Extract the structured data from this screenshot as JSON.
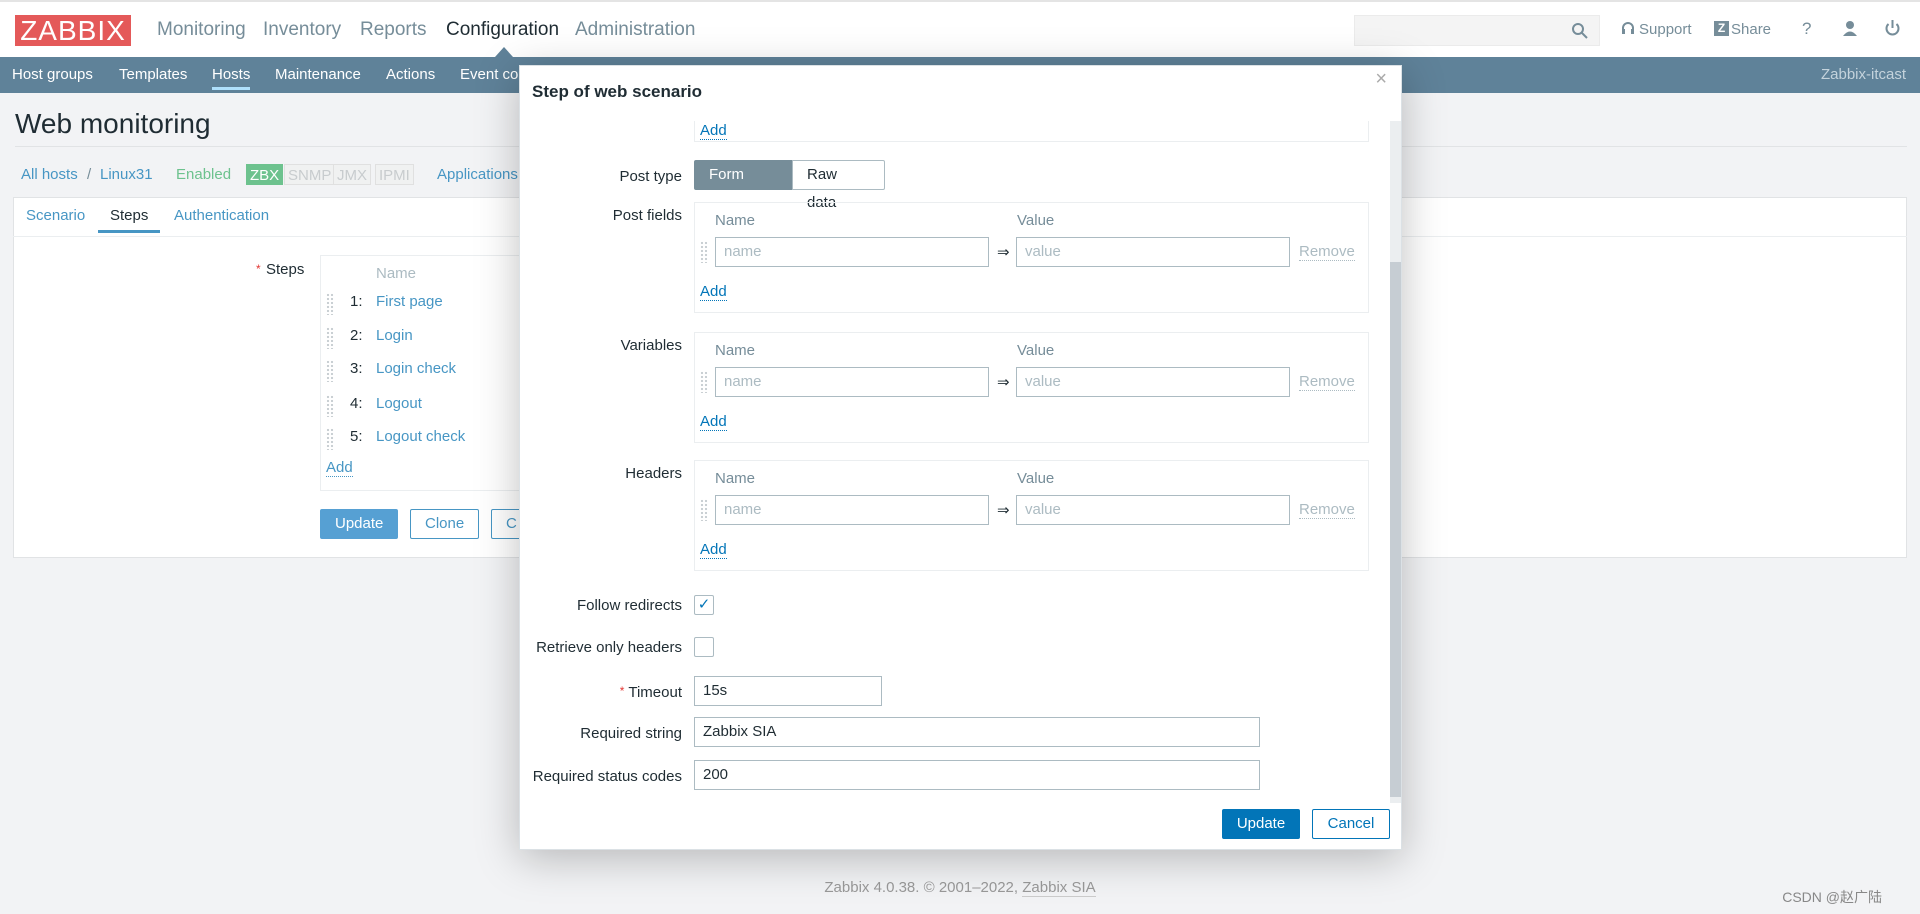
{
  "header": {
    "logo": "ZABBIX",
    "nav": [
      "Monitoring",
      "Inventory",
      "Reports",
      "Configuration",
      "Administration"
    ],
    "active_nav": "Configuration",
    "support": "Support",
    "share": "Share",
    "help": "?",
    "icons": [
      "search-icon",
      "headset-icon",
      "zabbix-share-icon",
      "help-icon",
      "user-icon",
      "power-icon"
    ]
  },
  "subnav": {
    "items": [
      "Host groups",
      "Templates",
      "Hosts",
      "Maintenance",
      "Actions",
      "Event co"
    ],
    "active": "Hosts",
    "server_name": "Zabbix-itcast"
  },
  "page": {
    "title": "Web monitoring",
    "breadcrumb": {
      "all_hosts": "All hosts",
      "sep": "/",
      "host": "Linux31",
      "status": "Enabled",
      "badges": [
        "ZBX",
        "SNMP",
        "JMX",
        "IPMI"
      ],
      "applications": "Applications"
    },
    "tabs": [
      "Scenario",
      "Steps",
      "Authentication"
    ],
    "active_tab": "Steps",
    "steps": {
      "label": "Steps",
      "required": "*",
      "name_header": "Name",
      "rows": [
        {
          "num": "1:",
          "name": "First page"
        },
        {
          "num": "2:",
          "name": "Login"
        },
        {
          "num": "3:",
          "name": "Login check"
        },
        {
          "num": "4:",
          "name": "Logout"
        },
        {
          "num": "5:",
          "name": "Logout check"
        }
      ],
      "add": "Add"
    },
    "buttons": {
      "update": "Update",
      "clone": "Clone",
      "third": "C"
    }
  },
  "dialog": {
    "title": "Step of web scenario",
    "close": "×",
    "top_add": "Add",
    "post_type": {
      "label": "Post type",
      "options": [
        "Form data",
        "Raw data"
      ],
      "selected": "Form data"
    },
    "sections": [
      {
        "label": "Post fields",
        "name_header": "Name",
        "value_header": "Value",
        "name_placeholder": "name",
        "value_placeholder": "value",
        "arrow": "⇒",
        "remove": "Remove",
        "add": "Add"
      },
      {
        "label": "Variables",
        "name_header": "Name",
        "value_header": "Value",
        "name_placeholder": "name",
        "value_placeholder": "value",
        "arrow": "⇒",
        "remove": "Remove",
        "add": "Add"
      },
      {
        "label": "Headers",
        "name_header": "Name",
        "value_header": "Value",
        "name_placeholder": "name",
        "value_placeholder": "value",
        "arrow": "⇒",
        "remove": "Remove",
        "add": "Add"
      }
    ],
    "follow_redirects": {
      "label": "Follow redirects",
      "checked": true,
      "mark": "✓"
    },
    "retrieve_only_headers": {
      "label": "Retrieve only headers",
      "checked": false
    },
    "timeout": {
      "label": "Timeout",
      "required": "*",
      "value": "15s"
    },
    "required_string": {
      "label": "Required string",
      "value": "Zabbix SIA"
    },
    "status_codes": {
      "label": "Required status codes",
      "value": "200"
    },
    "update": "Update",
    "cancel": "Cancel"
  },
  "footer": {
    "text": "Zabbix 4.0.38. © 2001–2022, ",
    "link": "Zabbix SIA"
  },
  "watermark": "CSDN @赵广陆",
  "colors": {
    "logo": "#e45959",
    "subnav": "#5f8299",
    "link": "#4796c4",
    "primary": "#0275b8",
    "zbx_badge": "#6dc28e"
  }
}
